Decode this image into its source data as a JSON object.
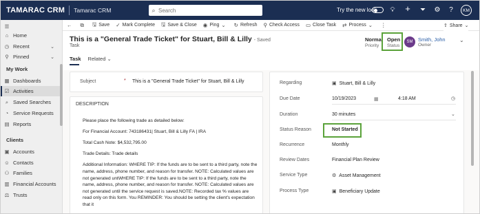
{
  "topbar": {
    "brand": "TAMARAC CRM",
    "app_name": "Tamarac CRM",
    "search_placeholder": "Search",
    "new_look_label": "Try the new look",
    "user_initials": "KM"
  },
  "sidebar": {
    "items": [
      {
        "label": "Home",
        "icon": "home-icon"
      },
      {
        "label": "Recent",
        "icon": "clock-icon"
      },
      {
        "label": "Pinned",
        "icon": "pin-icon"
      }
    ],
    "my_work_header": "My Work",
    "my_work": [
      {
        "label": "Dashboards",
        "icon": "dashboard-icon"
      },
      {
        "label": "Activities",
        "icon": "activities-icon"
      },
      {
        "label": "Saved Searches",
        "icon": "saved-search-icon"
      },
      {
        "label": "Service Requests",
        "icon": "service-request-icon"
      },
      {
        "label": "Reports",
        "icon": "report-icon"
      }
    ],
    "clients_header": "Clients",
    "clients": [
      {
        "label": "Accounts",
        "icon": "accounts-icon"
      },
      {
        "label": "Contacts",
        "icon": "contacts-icon"
      },
      {
        "label": "Families",
        "icon": "families-icon"
      },
      {
        "label": "Financial Accounts",
        "icon": "financial-accounts-icon"
      },
      {
        "label": "Trusts",
        "icon": "trusts-icon"
      }
    ]
  },
  "commandbar": {
    "save": "Save",
    "mark_complete": "Mark Complete",
    "save_close": "Save & Close",
    "ping": "Ping",
    "refresh": "Refresh",
    "check_access": "Check Access",
    "close_task": "Close Task",
    "process": "Process",
    "share": "Share"
  },
  "header": {
    "title": "This is a \"General Trade Ticket\" for Stuart, Bill & Lilly",
    "saved": "- Saved",
    "entity_type": "Task",
    "priority_value": "Normal",
    "priority_label": "Priority",
    "status_value": "Open",
    "status_label": "Status",
    "owner_initials": "SM",
    "owner_value": "Smith, John",
    "owner_label": "Owner",
    "tabs": [
      "Task",
      "Related"
    ]
  },
  "form": {
    "subject_label": "Subject",
    "subject_required": "*",
    "subject_value": "This is a \"General Trade Ticket\" for Stuart, Bill & Lilly",
    "description_header": "DESCRIPTION",
    "description_paragraphs": [
      "Please place the following trade as detailed below:",
      "For Financial Account:  743186431| Stuart, Bill & Lilly FA  | IRA",
      "Total Cash Note: $4,532,795.00",
      "Trade Details: Trade details",
      "Additional Information:  WHERE TIP: If the funds are to be sent to a third party, note the name, address, phone number, and reason for transfer. NOTE: Calculated values are not generated untWHERE TIP: If the funds are to be sent to a third party, note the name, address, phone number, and reason for transfer. NOTE: Calculated values are not generated until the service request is saved.NOTE: Recorded tax % values are read only on this form. You REMINDER: You should be setting the client's expectation that it"
    ]
  },
  "details": {
    "regarding_label": "Regarding",
    "regarding_value": "Stuart, Bill & Lilly",
    "due_date_label": "Due Date",
    "due_date_value": "10/19/2023",
    "due_time_value": "4:18 AM",
    "duration_label": "Duration",
    "duration_value": "30 minutes",
    "status_reason_label": "Status Reason",
    "status_reason_value": "Not Started",
    "recurrence_label": "Recurrence",
    "recurrence_value": "Monthly",
    "review_dates_label": "Review Dates",
    "review_dates_value": "Financial Plan Review",
    "service_type_label": "Service Type",
    "service_type_value": "Asset Management",
    "process_type_label": "Process Type",
    "process_type_value": "Beneficiary Update"
  },
  "colors": {
    "topbar": "#1b2e52",
    "highlight": "#5aa23a",
    "owner_avatar": "#6b3a8a",
    "link": "#2b5fa8"
  }
}
